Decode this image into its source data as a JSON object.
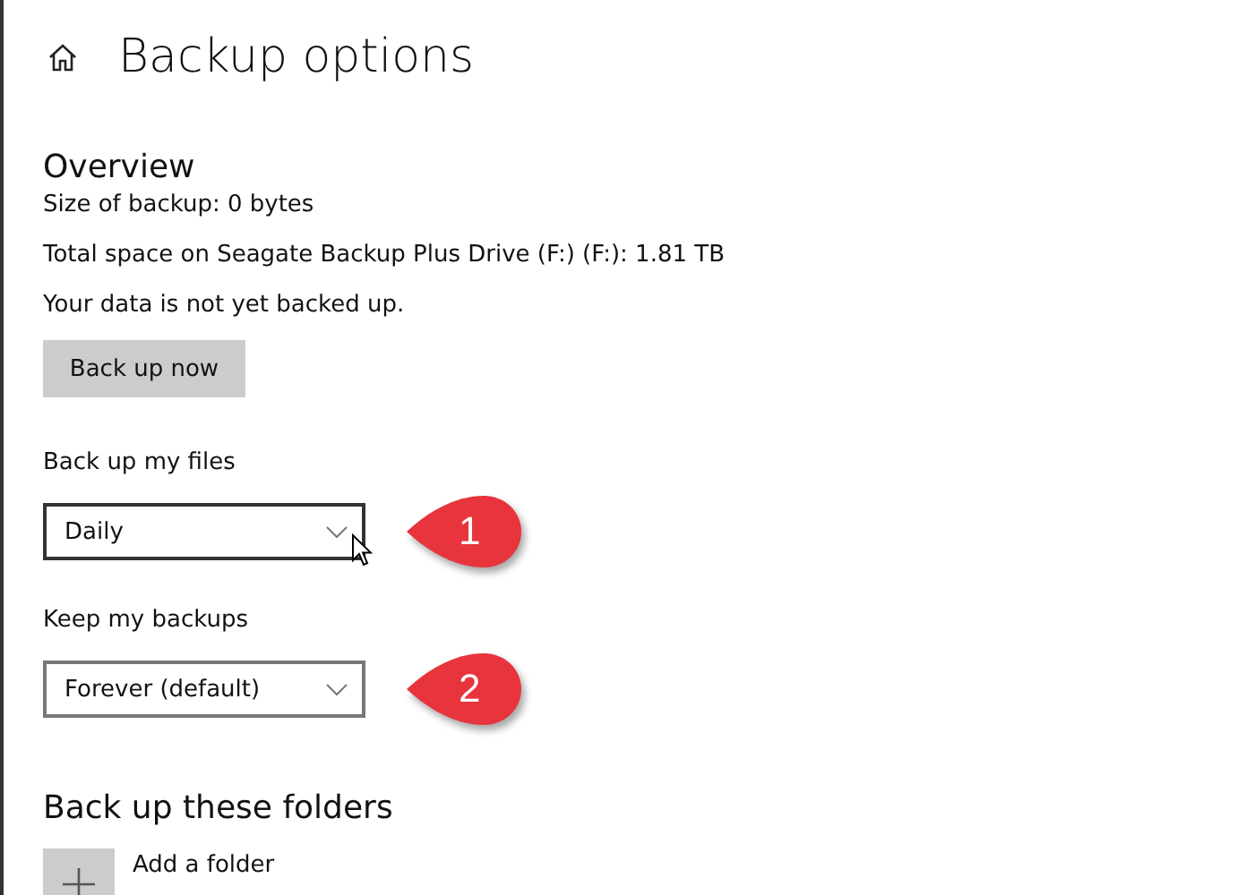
{
  "page": {
    "title": "Backup options"
  },
  "overview": {
    "heading": "Overview",
    "lines": [
      "Size of backup: 0 bytes",
      "Total space on Seagate Backup Plus Drive (F:) (F:): 1.81 TB",
      "Your data is not yet backed up."
    ],
    "button": "Back up now"
  },
  "settings": [
    {
      "label": "Back up my files",
      "value": "Daily",
      "callout": "1",
      "hovered": true
    },
    {
      "label": "Keep my backups",
      "value": "Forever (default)",
      "callout": "2",
      "hovered": false
    }
  ],
  "folders": {
    "heading": "Back up these folders",
    "add_label": "Add a folder"
  }
}
